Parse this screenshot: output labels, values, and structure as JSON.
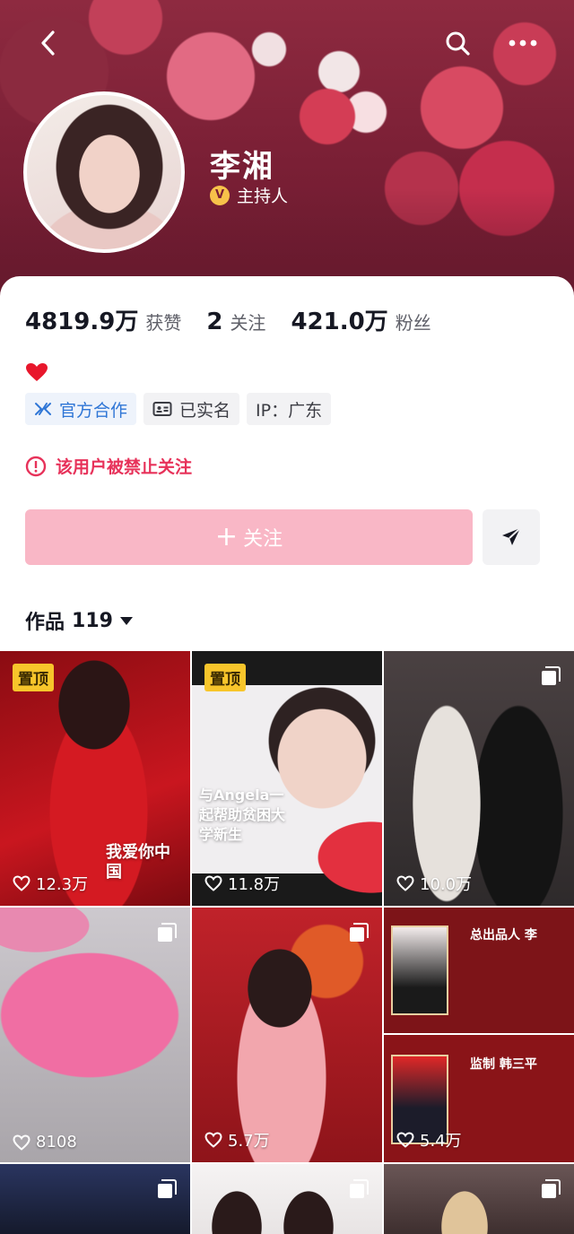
{
  "profile": {
    "name": "李湘",
    "role": "主持人",
    "verify_badge": "V"
  },
  "stats": [
    {
      "value": "4819.9万",
      "label": "获赞"
    },
    {
      "value": "2",
      "label": "关注"
    },
    {
      "value": "421.0万",
      "label": "粉丝"
    }
  ],
  "tags": [
    {
      "label": "官方合作",
      "icon": "cooperation-icon"
    },
    {
      "label": "已实名",
      "icon": "id-card-icon"
    },
    {
      "label": "IP：广东"
    }
  ],
  "warning": "该用户被禁止关注",
  "follow_button": {
    "plus": "+",
    "label": "关注"
  },
  "works": {
    "label": "作品",
    "count": "119"
  },
  "pin_label": "置顶",
  "tiles": [
    {
      "likes": "12.3万",
      "pinned": true,
      "overlay": "我爱你中国",
      "bg": "#c9161f"
    },
    {
      "likes": "11.8万",
      "pinned": true,
      "overlay": "与Angela一起帮助贫困大学新生",
      "bg": "#e6e2e6"
    },
    {
      "likes": "10.0万",
      "pinned": false,
      "bg": "#3a3536"
    },
    {
      "likes": "8108",
      "pinned": false,
      "bg": "#c9c6cb"
    },
    {
      "likes": "5.7万",
      "pinned": false,
      "bg": "#b21e23"
    },
    {
      "likes": "5.4万",
      "pinned": false,
      "top_title": "总出品人 李",
      "bottom_title": "监制 韩三平",
      "bg": "#7d1418"
    },
    {
      "pinned": false,
      "bg": "#1f2740"
    },
    {
      "pinned": false,
      "bg": "#f0eeee"
    },
    {
      "pinned": false,
      "bg": "#5a4646"
    }
  ],
  "colors": {
    "accent_pink": "#f9b7c6",
    "warning_red": "#e7325a",
    "pin_yellow": "#f7c52b"
  }
}
